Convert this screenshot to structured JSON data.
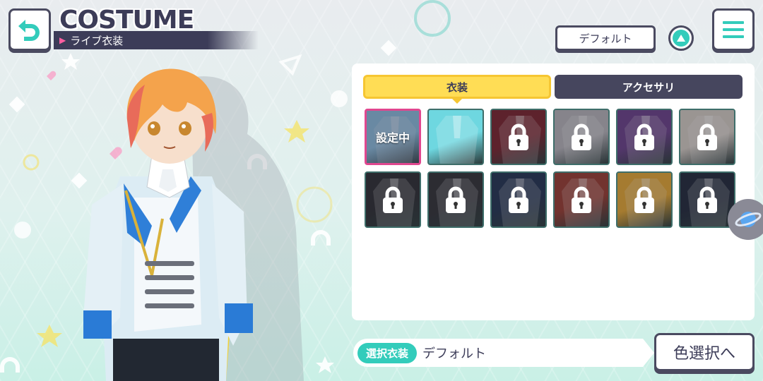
{
  "header": {
    "title": "COSTUME",
    "subtitle": "ライブ衣装",
    "default_button": "デフォルト"
  },
  "tabs": {
    "costume": "衣装",
    "accessory": "アクセサリ"
  },
  "grid": {
    "equipped_label": "設定中",
    "items": [
      {
        "state": "equipped",
        "color": "#8ec9e8"
      },
      {
        "state": "available",
        "color": "#6ed7e0"
      },
      {
        "state": "locked",
        "color": "#7a1f2a"
      },
      {
        "state": "locked",
        "color": "#b9b6bc"
      },
      {
        "state": "locked",
        "color": "#6a3e8a"
      },
      {
        "state": "locked",
        "color": "#d8cfc7"
      },
      {
        "state": "locked",
        "color": "#2a2a30"
      },
      {
        "state": "locked",
        "color": "#2e2e34"
      },
      {
        "state": "locked",
        "color": "#203050"
      },
      {
        "state": "locked",
        "color": "#9a3a2e"
      },
      {
        "state": "locked",
        "color": "#e8a830"
      },
      {
        "state": "locked",
        "color": "#1e2638"
      }
    ]
  },
  "footer": {
    "selected_label": "選択衣装",
    "selected_value": "デフォルト",
    "color_button": "色選択へ"
  },
  "colors": {
    "accent": "#33ccbb",
    "navy": "#3c3c58",
    "tab_active": "#ffdd55",
    "selected_border": "#e0478f"
  }
}
